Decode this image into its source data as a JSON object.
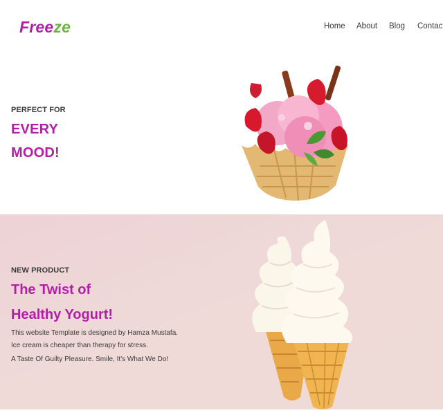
{
  "header": {
    "logo_part1": "Free",
    "logo_part2": "ze",
    "nav": [
      "Home",
      "About",
      "Blog",
      "Contact"
    ]
  },
  "hero": {
    "eyebrow": "PERFECT FOR",
    "title_line1": "EVERY",
    "title_line2": "MOOD!",
    "image": "ice-cream-bowl-with-strawberries"
  },
  "product": {
    "eyebrow": "NEW PRODUCT",
    "title_line1": "The Twist of",
    "title_line2": "Healthy Yogurt!",
    "lines": [
      "This website Template is designed by Hamza Mustafa.",
      "Ice cream is cheaper than therapy for stress.",
      "A Taste Of Guilty Pleasure. Smile, It's What We Do!"
    ],
    "image": "two-soft-serve-cones"
  },
  "colors": {
    "brand": "#b21fa5",
    "accent_green": "#6db33f",
    "section_bg": "#eed6d6",
    "text": "#3a3a3a"
  }
}
